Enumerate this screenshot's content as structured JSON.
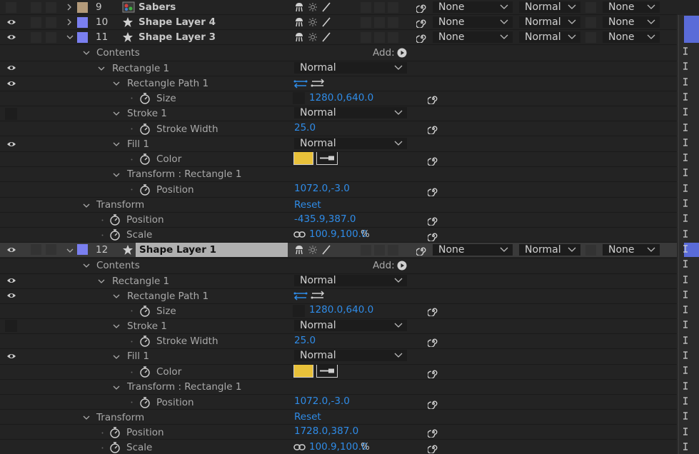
{
  "layers": [
    {
      "num": "9",
      "name": "Sabers",
      "type": "footage",
      "color": "#b39a7a",
      "mode": "None",
      "blend": "Normal",
      "track": "None"
    },
    {
      "num": "10",
      "name": "Shape Layer 4",
      "type": "shape",
      "color": "#7a7ff0",
      "mode": "None",
      "blend": "Normal",
      "track": "None"
    },
    {
      "num": "11",
      "name": "Shape Layer 3",
      "type": "shape",
      "color": "#7a7ff0",
      "mode": "None",
      "blend": "Normal",
      "track": "None"
    },
    {
      "num": "12",
      "name": "Shape Layer 1",
      "type": "shape",
      "color": "#7a7ff0",
      "mode": "None",
      "blend": "Normal",
      "track": "None"
    }
  ],
  "props": {
    "contents": "Contents",
    "add": "Add:",
    "rectangle1": "Rectangle 1",
    "rect_path1": "Rectangle Path 1",
    "size": "Size",
    "stroke1": "Stroke 1",
    "stroke_width": "Stroke Width",
    "fill1": "Fill 1",
    "color": "Color",
    "transform_rect": "Transform : Rectangle 1",
    "position": "Position",
    "transform": "Transform",
    "scale": "Scale",
    "reset": "Reset",
    "normal": "Normal",
    "percent": "%"
  },
  "l11": {
    "size": "1280.0,640.0",
    "stroke_width": "25.0",
    "rect_position": "1072.0,-3.0",
    "position": "-435.9,387.0",
    "scale": "100.9,100.0"
  },
  "l12": {
    "size": "1280.0,640.0",
    "stroke_width": "25.0",
    "rect_position": "1072.0,-3.0",
    "position": "1728.0,387.0",
    "scale": "100.9,100.0"
  },
  "colors": {
    "fill_yellow": "#e8c13a",
    "value_blue": "#2f8ce8",
    "label_purple": "#7a7ff0",
    "label_tan": "#b39a7a",
    "selected_bg": "#3a3a3a",
    "name_highlight": "#b0b0b0"
  }
}
